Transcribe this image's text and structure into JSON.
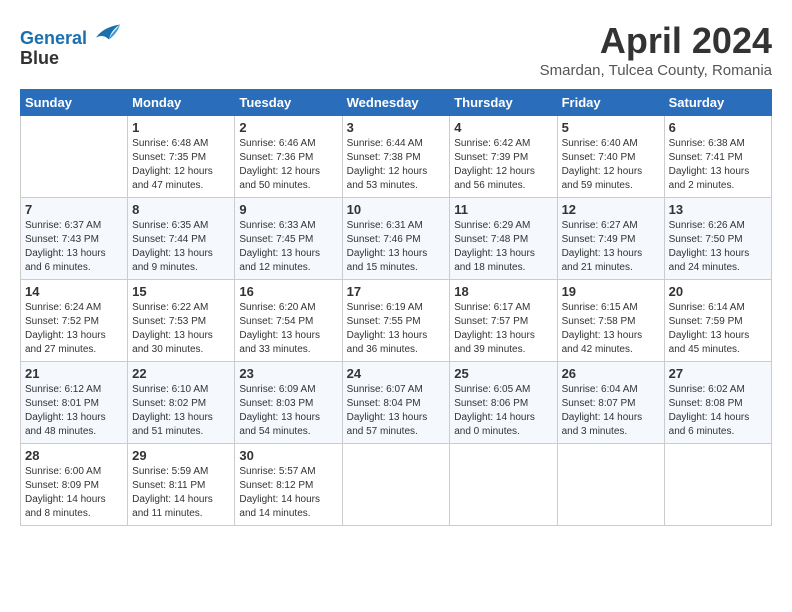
{
  "logo": {
    "line1": "General",
    "line2": "Blue"
  },
  "title": "April 2024",
  "subtitle": "Smardan, Tulcea County, Romania",
  "days_of_week": [
    "Sunday",
    "Monday",
    "Tuesday",
    "Wednesday",
    "Thursday",
    "Friday",
    "Saturday"
  ],
  "weeks": [
    [
      {
        "day": "",
        "sunrise": "",
        "sunset": "",
        "daylight": ""
      },
      {
        "day": "1",
        "sunrise": "Sunrise: 6:48 AM",
        "sunset": "Sunset: 7:35 PM",
        "daylight": "Daylight: 12 hours and 47 minutes."
      },
      {
        "day": "2",
        "sunrise": "Sunrise: 6:46 AM",
        "sunset": "Sunset: 7:36 PM",
        "daylight": "Daylight: 12 hours and 50 minutes."
      },
      {
        "day": "3",
        "sunrise": "Sunrise: 6:44 AM",
        "sunset": "Sunset: 7:38 PM",
        "daylight": "Daylight: 12 hours and 53 minutes."
      },
      {
        "day": "4",
        "sunrise": "Sunrise: 6:42 AM",
        "sunset": "Sunset: 7:39 PM",
        "daylight": "Daylight: 12 hours and 56 minutes."
      },
      {
        "day": "5",
        "sunrise": "Sunrise: 6:40 AM",
        "sunset": "Sunset: 7:40 PM",
        "daylight": "Daylight: 12 hours and 59 minutes."
      },
      {
        "day": "6",
        "sunrise": "Sunrise: 6:38 AM",
        "sunset": "Sunset: 7:41 PM",
        "daylight": "Daylight: 13 hours and 2 minutes."
      }
    ],
    [
      {
        "day": "7",
        "sunrise": "Sunrise: 6:37 AM",
        "sunset": "Sunset: 7:43 PM",
        "daylight": "Daylight: 13 hours and 6 minutes."
      },
      {
        "day": "8",
        "sunrise": "Sunrise: 6:35 AM",
        "sunset": "Sunset: 7:44 PM",
        "daylight": "Daylight: 13 hours and 9 minutes."
      },
      {
        "day": "9",
        "sunrise": "Sunrise: 6:33 AM",
        "sunset": "Sunset: 7:45 PM",
        "daylight": "Daylight: 13 hours and 12 minutes."
      },
      {
        "day": "10",
        "sunrise": "Sunrise: 6:31 AM",
        "sunset": "Sunset: 7:46 PM",
        "daylight": "Daylight: 13 hours and 15 minutes."
      },
      {
        "day": "11",
        "sunrise": "Sunrise: 6:29 AM",
        "sunset": "Sunset: 7:48 PM",
        "daylight": "Daylight: 13 hours and 18 minutes."
      },
      {
        "day": "12",
        "sunrise": "Sunrise: 6:27 AM",
        "sunset": "Sunset: 7:49 PM",
        "daylight": "Daylight: 13 hours and 21 minutes."
      },
      {
        "day": "13",
        "sunrise": "Sunrise: 6:26 AM",
        "sunset": "Sunset: 7:50 PM",
        "daylight": "Daylight: 13 hours and 24 minutes."
      }
    ],
    [
      {
        "day": "14",
        "sunrise": "Sunrise: 6:24 AM",
        "sunset": "Sunset: 7:52 PM",
        "daylight": "Daylight: 13 hours and 27 minutes."
      },
      {
        "day": "15",
        "sunrise": "Sunrise: 6:22 AM",
        "sunset": "Sunset: 7:53 PM",
        "daylight": "Daylight: 13 hours and 30 minutes."
      },
      {
        "day": "16",
        "sunrise": "Sunrise: 6:20 AM",
        "sunset": "Sunset: 7:54 PM",
        "daylight": "Daylight: 13 hours and 33 minutes."
      },
      {
        "day": "17",
        "sunrise": "Sunrise: 6:19 AM",
        "sunset": "Sunset: 7:55 PM",
        "daylight": "Daylight: 13 hours and 36 minutes."
      },
      {
        "day": "18",
        "sunrise": "Sunrise: 6:17 AM",
        "sunset": "Sunset: 7:57 PM",
        "daylight": "Daylight: 13 hours and 39 minutes."
      },
      {
        "day": "19",
        "sunrise": "Sunrise: 6:15 AM",
        "sunset": "Sunset: 7:58 PM",
        "daylight": "Daylight: 13 hours and 42 minutes."
      },
      {
        "day": "20",
        "sunrise": "Sunrise: 6:14 AM",
        "sunset": "Sunset: 7:59 PM",
        "daylight": "Daylight: 13 hours and 45 minutes."
      }
    ],
    [
      {
        "day": "21",
        "sunrise": "Sunrise: 6:12 AM",
        "sunset": "Sunset: 8:01 PM",
        "daylight": "Daylight: 13 hours and 48 minutes."
      },
      {
        "day": "22",
        "sunrise": "Sunrise: 6:10 AM",
        "sunset": "Sunset: 8:02 PM",
        "daylight": "Daylight: 13 hours and 51 minutes."
      },
      {
        "day": "23",
        "sunrise": "Sunrise: 6:09 AM",
        "sunset": "Sunset: 8:03 PM",
        "daylight": "Daylight: 13 hours and 54 minutes."
      },
      {
        "day": "24",
        "sunrise": "Sunrise: 6:07 AM",
        "sunset": "Sunset: 8:04 PM",
        "daylight": "Daylight: 13 hours and 57 minutes."
      },
      {
        "day": "25",
        "sunrise": "Sunrise: 6:05 AM",
        "sunset": "Sunset: 8:06 PM",
        "daylight": "Daylight: 14 hours and 0 minutes."
      },
      {
        "day": "26",
        "sunrise": "Sunrise: 6:04 AM",
        "sunset": "Sunset: 8:07 PM",
        "daylight": "Daylight: 14 hours and 3 minutes."
      },
      {
        "day": "27",
        "sunrise": "Sunrise: 6:02 AM",
        "sunset": "Sunset: 8:08 PM",
        "daylight": "Daylight: 14 hours and 6 minutes."
      }
    ],
    [
      {
        "day": "28",
        "sunrise": "Sunrise: 6:00 AM",
        "sunset": "Sunset: 8:09 PM",
        "daylight": "Daylight: 14 hours and 8 minutes."
      },
      {
        "day": "29",
        "sunrise": "Sunrise: 5:59 AM",
        "sunset": "Sunset: 8:11 PM",
        "daylight": "Daylight: 14 hours and 11 minutes."
      },
      {
        "day": "30",
        "sunrise": "Sunrise: 5:57 AM",
        "sunset": "Sunset: 8:12 PM",
        "daylight": "Daylight: 14 hours and 14 minutes."
      },
      {
        "day": "",
        "sunrise": "",
        "sunset": "",
        "daylight": ""
      },
      {
        "day": "",
        "sunrise": "",
        "sunset": "",
        "daylight": ""
      },
      {
        "day": "",
        "sunrise": "",
        "sunset": "",
        "daylight": ""
      },
      {
        "day": "",
        "sunrise": "",
        "sunset": "",
        "daylight": ""
      }
    ]
  ]
}
